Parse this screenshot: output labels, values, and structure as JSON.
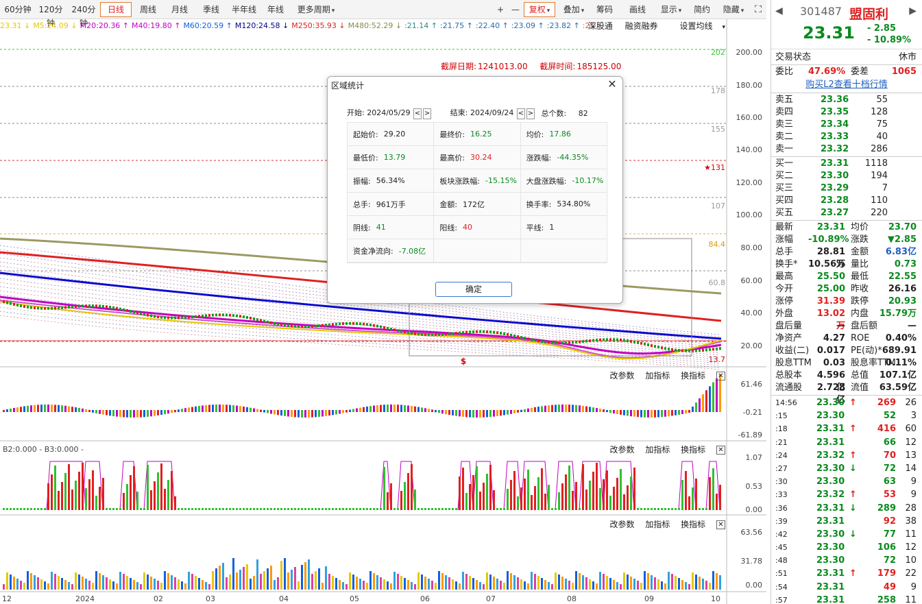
{
  "toolbar": {
    "periods": [
      "60分钟",
      "120分钟",
      "240分钟",
      "日线",
      "周线",
      "月线",
      "季线",
      "半年线",
      "年线",
      "更多周期"
    ],
    "selected_period": "日线",
    "right_buttons": [
      "复权",
      "叠加",
      "筹码",
      "画线",
      "显示",
      "简约",
      "隐藏"
    ],
    "zoom_in": "+",
    "zoom_out": "—"
  },
  "ma_bar": [
    {
      "text": "23.31 ↓",
      "color": "#e6c800"
    },
    {
      "text": "M5:24.09 ↓",
      "color": "#e6c800"
    },
    {
      "text": "M20:20.36 ↑",
      "color": "#c000c0"
    },
    {
      "text": "M40:19.80 ↑",
      "color": "#c000c0"
    },
    {
      "text": "M60:20.59 ↑",
      "color": "#1060e0"
    },
    {
      "text": "M120:24.58 ↓",
      "color": "#00008b"
    },
    {
      "text": "M250:35.93 ↓",
      "color": "#e02020"
    },
    {
      "text": "M480:52.29 ↓",
      "color": "#8a8a50"
    },
    {
      "text": ":21.14 ↑",
      "color": "#2a8a8a"
    },
    {
      "text": ":21.75 ↑",
      "color": "#2a6aaa"
    },
    {
      "text": ":22.40 ↑",
      "color": "#2a6aaa"
    },
    {
      "text": ":23.09 ↑",
      "color": "#2a6aaa"
    },
    {
      "text": ":23.82 ↑",
      "color": "#2a6aaa"
    },
    {
      "text": ":25",
      "color": "#cc6666"
    }
  ],
  "chart_tools": [
    "深股通",
    "融资融券",
    "设置均线"
  ],
  "screenshot_stamp": {
    "date_label": "截屏日期:",
    "date_value": "1241013.00",
    "time_label": "截屏时间:",
    "time_value": "185125.00"
  },
  "y_axis_main": [
    "200.00",
    "180.00",
    "160.00",
    "140.00",
    "120.00",
    "100.00",
    "80.00",
    "60.00",
    "40.00",
    "20.00"
  ],
  "price_marks": [
    "202",
    "178",
    "155",
    "★131",
    "107",
    "84.4",
    "60.8",
    "13.7"
  ],
  "sub1": {
    "tools": [
      "改参数",
      "加指标",
      "换指标"
    ],
    "axis": [
      "61.46",
      "-0.21",
      "-61.89"
    ]
  },
  "sub2": {
    "legend": "B2:0.000 - B3:0.000 -",
    "tools": [
      "改参数",
      "加指标",
      "换指标"
    ],
    "axis": [
      "1.07",
      "0.53",
      "0.00"
    ]
  },
  "sub3": {
    "tools": [
      "改参数",
      "加指标",
      "换指标"
    ],
    "axis": [
      "63.56",
      "31.78",
      "0.00"
    ]
  },
  "x_axis": [
    "12",
    "2024",
    "02",
    "03",
    "04",
    "05",
    "06",
    "07",
    "08",
    "09",
    "10"
  ],
  "dialog": {
    "title": "区域统计",
    "start_label": "开始:",
    "start_value": "2024/05/29",
    "end_label": "结束:",
    "end_value": "2024/09/24",
    "count_label": "总个数:",
    "count_value": "82",
    "rows": [
      [
        {
          "k": "起始价:",
          "v": "29.20",
          "c": ""
        },
        {
          "k": "最终价:",
          "v": "16.25",
          "c": "green"
        },
        {
          "k": "均价:",
          "v": "17.86",
          "c": "green"
        }
      ],
      [
        {
          "k": "最低价:",
          "v": "13.79",
          "c": "green"
        },
        {
          "k": "最高价:",
          "v": "30.24",
          "c": "red"
        },
        {
          "k": "涨跌幅:",
          "v": "-44.35%",
          "c": "green"
        }
      ],
      [
        {
          "k": "振幅:",
          "v": "56.34%",
          "c": ""
        },
        {
          "k": "板块涨跌幅:",
          "v": "-15.15%",
          "c": "green"
        },
        {
          "k": "大盘涨跌幅:",
          "v": "-10.17%",
          "c": "green"
        }
      ],
      [
        {
          "k": "总手:",
          "v": "961万手",
          "c": ""
        },
        {
          "k": "金额:",
          "v": "172亿",
          "c": ""
        },
        {
          "k": "换手率:",
          "v": "534.80%",
          "c": ""
        }
      ],
      [
        {
          "k": "阴线:",
          "v": "41",
          "c": "green"
        },
        {
          "k": "阳线:",
          "v": "40",
          "c": "red"
        },
        {
          "k": "平线:",
          "v": "1",
          "c": ""
        }
      ],
      [
        {
          "k": "资金净流向:",
          "v": "-7.08亿",
          "c": "green"
        },
        {
          "k": "",
          "v": "",
          "c": ""
        },
        {
          "k": "",
          "v": "",
          "c": ""
        }
      ]
    ],
    "ok": "确定"
  },
  "panel": {
    "code": "301487",
    "name": "盟固利",
    "price": "23.31",
    "change": "- 2.85",
    "change_pct": "- 10.89%",
    "status_label": "交易状态",
    "status_value": "休市",
    "wb_label": "委比",
    "wb_value": "47.69%",
    "wc_label": "委差",
    "wc_value": "1065",
    "l2_link": "购买L2查看十档行情",
    "asks": [
      {
        "label": "卖五",
        "price": "23.36",
        "vol": "55"
      },
      {
        "label": "卖四",
        "price": "23.35",
        "vol": "128"
      },
      {
        "label": "卖三",
        "price": "23.34",
        "vol": "75"
      },
      {
        "label": "卖二",
        "price": "23.33",
        "vol": "40"
      },
      {
        "label": "卖一",
        "price": "23.32",
        "vol": "286"
      }
    ],
    "bids": [
      {
        "label": "买一",
        "price": "23.31",
        "vol": "1118"
      },
      {
        "label": "买二",
        "price": "23.30",
        "vol": "194"
      },
      {
        "label": "买三",
        "price": "23.29",
        "vol": "7"
      },
      {
        "label": "买四",
        "price": "23.28",
        "vol": "110"
      },
      {
        "label": "买五",
        "price": "23.27",
        "vol": "220"
      }
    ],
    "stats": [
      {
        "l": "最新",
        "v": "23.31",
        "vc": "green",
        "l2": "均价",
        "v2": "23.70",
        "v2c": "green"
      },
      {
        "l": "涨幅",
        "v": "-10.89%",
        "vc": "green",
        "l2": "涨跌",
        "v2": "▼2.85",
        "v2c": "green"
      },
      {
        "l": "总手",
        "v": "28.81万",
        "vc": "",
        "l2": "金额",
        "v2": "6.83亿",
        "v2c": "blue"
      },
      {
        "l": "换手*",
        "v": "10.56%",
        "vc": "",
        "l2": "量比",
        "v2": "0.73",
        "v2c": "green"
      },
      {
        "l": "最高",
        "v": "25.50",
        "vc": "green",
        "l2": "最低",
        "v2": "22.55",
        "v2c": "green"
      },
      {
        "l": "今开",
        "v": "25.00",
        "vc": "green",
        "l2": "昨收",
        "v2": "26.16",
        "v2c": ""
      },
      {
        "l": "涨停",
        "v": "31.39",
        "vc": "red",
        "l2": "跌停",
        "v2": "20.93",
        "v2c": "green"
      },
      {
        "l": "外盘",
        "v": "13.02万",
        "vc": "red",
        "l2": "内盘",
        "v2": "15.79万",
        "v2c": "green"
      },
      {
        "l": "盘后量",
        "v": "—",
        "vc": "",
        "l2": "盘后额",
        "v2": "—",
        "v2c": ""
      },
      {
        "l": "净资产",
        "v": "4.27",
        "vc": "",
        "l2": "ROE",
        "v2": "0.40%",
        "v2c": ""
      },
      {
        "l": "收益(二)",
        "v": "0.017",
        "vc": "",
        "l2": "PE(动)*",
        "v2": "689.91",
        "v2c": ""
      },
      {
        "l": "股息TTM",
        "v": "0.03",
        "vc": "",
        "l2": "股息率TTM",
        "v2": "0.11%",
        "v2c": ""
      },
      {
        "l": "总股本",
        "v": "4.596亿",
        "vc": "",
        "l2": "总值",
        "v2": "107.1亿",
        "v2c": ""
      },
      {
        "l": "流通股",
        "v": "2.728亿",
        "vc": "",
        "l2": "流值",
        "v2": "63.59亿",
        "v2c": ""
      }
    ],
    "ticks": [
      {
        "t": "14:56",
        "p": "23.30",
        "a": "↑",
        "ac": "red",
        "v": "269",
        "vc": "red",
        "n": "26"
      },
      {
        "t": ":15",
        "p": "23.30",
        "a": "",
        "ac": "",
        "v": "52",
        "vc": "green",
        "n": "3"
      },
      {
        "t": ":18",
        "p": "23.31",
        "a": "↑",
        "ac": "red",
        "v": "416",
        "vc": "red",
        "n": "60"
      },
      {
        "t": ":21",
        "p": "23.31",
        "a": "",
        "ac": "",
        "v": "66",
        "vc": "green",
        "n": "12"
      },
      {
        "t": ":24",
        "p": "23.32",
        "a": "↑",
        "ac": "red",
        "v": "70",
        "vc": "red",
        "n": "13"
      },
      {
        "t": ":27",
        "p": "23.30",
        "a": "↓",
        "ac": "green",
        "v": "72",
        "vc": "green",
        "n": "14"
      },
      {
        "t": ":30",
        "p": "23.30",
        "a": "",
        "ac": "",
        "v": "63",
        "vc": "green",
        "n": "9"
      },
      {
        "t": ":33",
        "p": "23.32",
        "a": "↑",
        "ac": "red",
        "v": "53",
        "vc": "red",
        "n": "9"
      },
      {
        "t": ":36",
        "p": "23.31",
        "a": "↓",
        "ac": "green",
        "v": "289",
        "vc": "green",
        "n": "28"
      },
      {
        "t": ":39",
        "p": "23.31",
        "a": "",
        "ac": "",
        "v": "92",
        "vc": "red",
        "n": "38"
      },
      {
        "t": ":42",
        "p": "23.30",
        "a": "↓",
        "ac": "green",
        "v": "77",
        "vc": "green",
        "n": "11"
      },
      {
        "t": ":45",
        "p": "23.30",
        "a": "",
        "ac": "",
        "v": "106",
        "vc": "green",
        "n": "12"
      },
      {
        "t": ":48",
        "p": "23.30",
        "a": "",
        "ac": "",
        "v": "72",
        "vc": "green",
        "n": "10"
      },
      {
        "t": ":51",
        "p": "23.31",
        "a": "↑",
        "ac": "red",
        "v": "179",
        "vc": "red",
        "n": "22"
      },
      {
        "t": ":54",
        "p": "23.31",
        "a": "",
        "ac": "",
        "v": "49",
        "vc": "red",
        "n": "9"
      },
      {
        "t": ":57",
        "p": "23.31",
        "a": "",
        "ac": "",
        "v": "258",
        "vc": "green",
        "n": "11"
      }
    ]
  }
}
